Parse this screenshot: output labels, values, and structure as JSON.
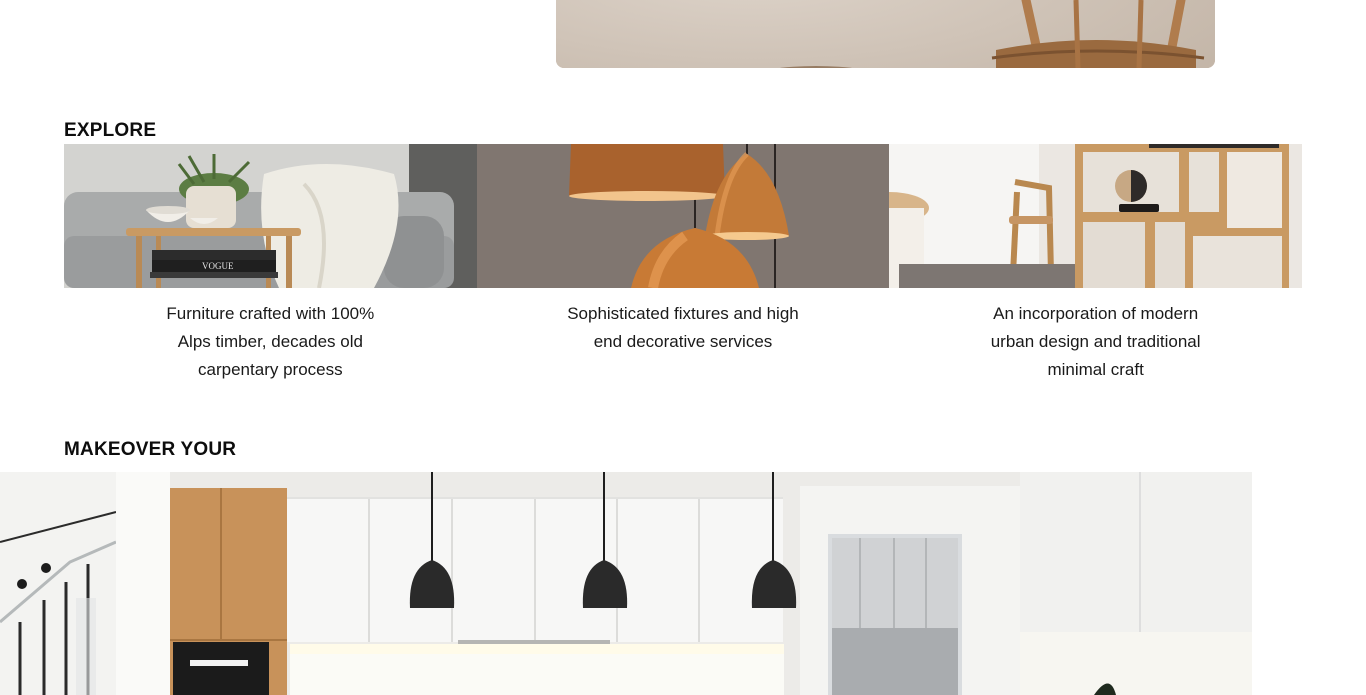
{
  "explore": {
    "heading": "EXPLORE",
    "cards": [
      {
        "caption": "Furniture crafted with 100% Alps timber, decades old carpentary process",
        "book_label": "VOGUE"
      },
      {
        "caption": "Sophisticated fixtures and high end decorative services"
      },
      {
        "caption": "An incorporation of modern urban design and traditional minimal craft"
      }
    ]
  },
  "makeover": {
    "heading": "MAKEOVER YOUR"
  },
  "colors": {
    "background": "#ffffff",
    "heading": "#0d0d0d",
    "caption": "#1a1a1a",
    "timber": "#c99a63",
    "copper": "#c37a38"
  }
}
